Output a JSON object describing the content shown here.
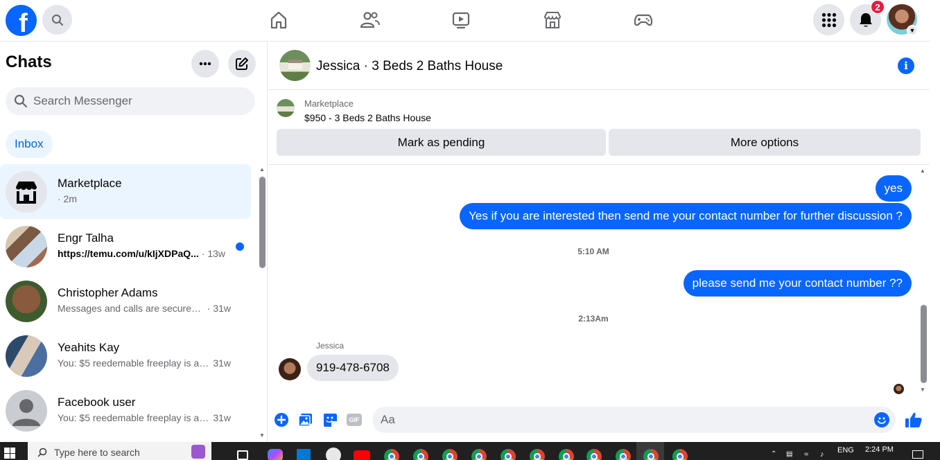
{
  "topbar": {
    "logo": "f",
    "notifications_badge": "2"
  },
  "sidebar": {
    "title": "Chats",
    "search_placeholder": "Search Messenger",
    "filter_inbox": "Inbox",
    "chats": [
      {
        "name": "Marketplace",
        "snippet": "",
        "time": "· 2m",
        "unread": false,
        "active": true
      },
      {
        "name": "Engr Talha",
        "snippet": "https://temu.com/u/kIjXDPaQ...",
        "time": "· 13w",
        "unread": true,
        "active": false
      },
      {
        "name": "Christopher Adams",
        "snippet": "Messages and calls are secured wi...",
        "time": "· 31w",
        "unread": false,
        "active": false
      },
      {
        "name": "Yeahits Kay",
        "snippet": "You: $5 reedemable freeplay is av...",
        "time": "31w",
        "unread": false,
        "active": false
      },
      {
        "name": "Facebook user",
        "snippet": "You: $5 reedemable freeplay is av...",
        "time": "31w",
        "unread": false,
        "active": false
      }
    ]
  },
  "conversation": {
    "title": "Jessica · 3 Beds 2 Baths House",
    "marketplace_label": "Marketplace",
    "listing": "$950 - 3 Beds 2 Baths House",
    "btn_pending": "Mark as pending",
    "btn_more": "More options",
    "messages": [
      {
        "text": "yes"
      },
      {
        "text": "Yes if you are interested then send me your contact number for further discussion ?"
      },
      {
        "timestamp": "5:10 AM"
      },
      {
        "text": "please send me your contact number ??"
      },
      {
        "timestamp": "2:13Am"
      }
    ],
    "incoming_sender": "Jessica",
    "incoming_text": "919-478-6708",
    "composer_placeholder": "Aa",
    "gif_label": "GIF"
  },
  "taskbar": {
    "search_placeholder": "Type here to search",
    "lang": "ENG",
    "time": "2:24 PM"
  },
  "colors": {
    "accent": "#0866ff",
    "badge": "#e41e3f",
    "active_bg": "#ebf5ff",
    "bubble_in": "#e4e6eb"
  }
}
